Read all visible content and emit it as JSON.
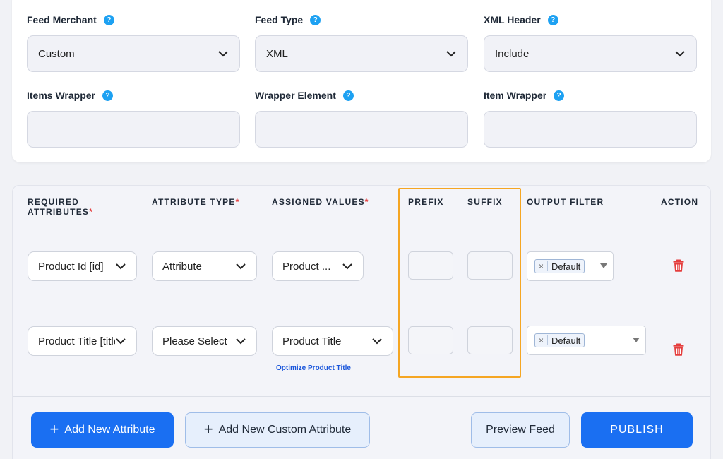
{
  "settings": {
    "feed_merchant": {
      "label": "Feed Merchant",
      "value": "Custom"
    },
    "feed_type": {
      "label": "Feed Type",
      "value": "XML"
    },
    "xml_header": {
      "label": "XML Header",
      "value": "Include"
    },
    "items_wrapper": {
      "label": "Items Wrapper",
      "value": ""
    },
    "wrapper_element": {
      "label": "Wrapper Element",
      "value": ""
    },
    "item_wrapper": {
      "label": "Item Wrapper",
      "value": ""
    },
    "help_glyph": "?"
  },
  "table": {
    "headers": {
      "required_attributes_line1": "REQUIRED",
      "required_attributes_line2": "ATTRIBUTES",
      "attribute_type": "ATTRIBUTE TYPE",
      "assigned_values": "ASSIGNED VALUES",
      "prefix": "PREFIX",
      "suffix": "SUFFIX",
      "output_filter": "OUTPUT FILTER",
      "action": "ACTION",
      "required_mark": "*"
    },
    "rows": [
      {
        "required_attribute": "Product Id [id]",
        "attribute_type": "Attribute",
        "assigned_value": "Product ...",
        "prefix": "",
        "suffix": "",
        "output_filter": "Default",
        "remove_glyph": "×"
      },
      {
        "required_attribute": "Product Title [title",
        "attribute_type": "Please Select",
        "assigned_value": "Product Title",
        "prefix": "",
        "suffix": "",
        "output_filter": "Default",
        "remove_glyph": "×",
        "link": "Optimize Product Title"
      }
    ]
  },
  "actions": {
    "add_attribute": "Add New Attribute",
    "add_custom_attribute": "Add New Custom Attribute",
    "preview_feed": "Preview Feed",
    "publish": "PUBLISH",
    "plus_glyph": "+"
  },
  "colors": {
    "accent": "#1a6ff2",
    "help": "#1da1f2",
    "danger": "#e53e3e",
    "highlight": "#f5a623"
  }
}
